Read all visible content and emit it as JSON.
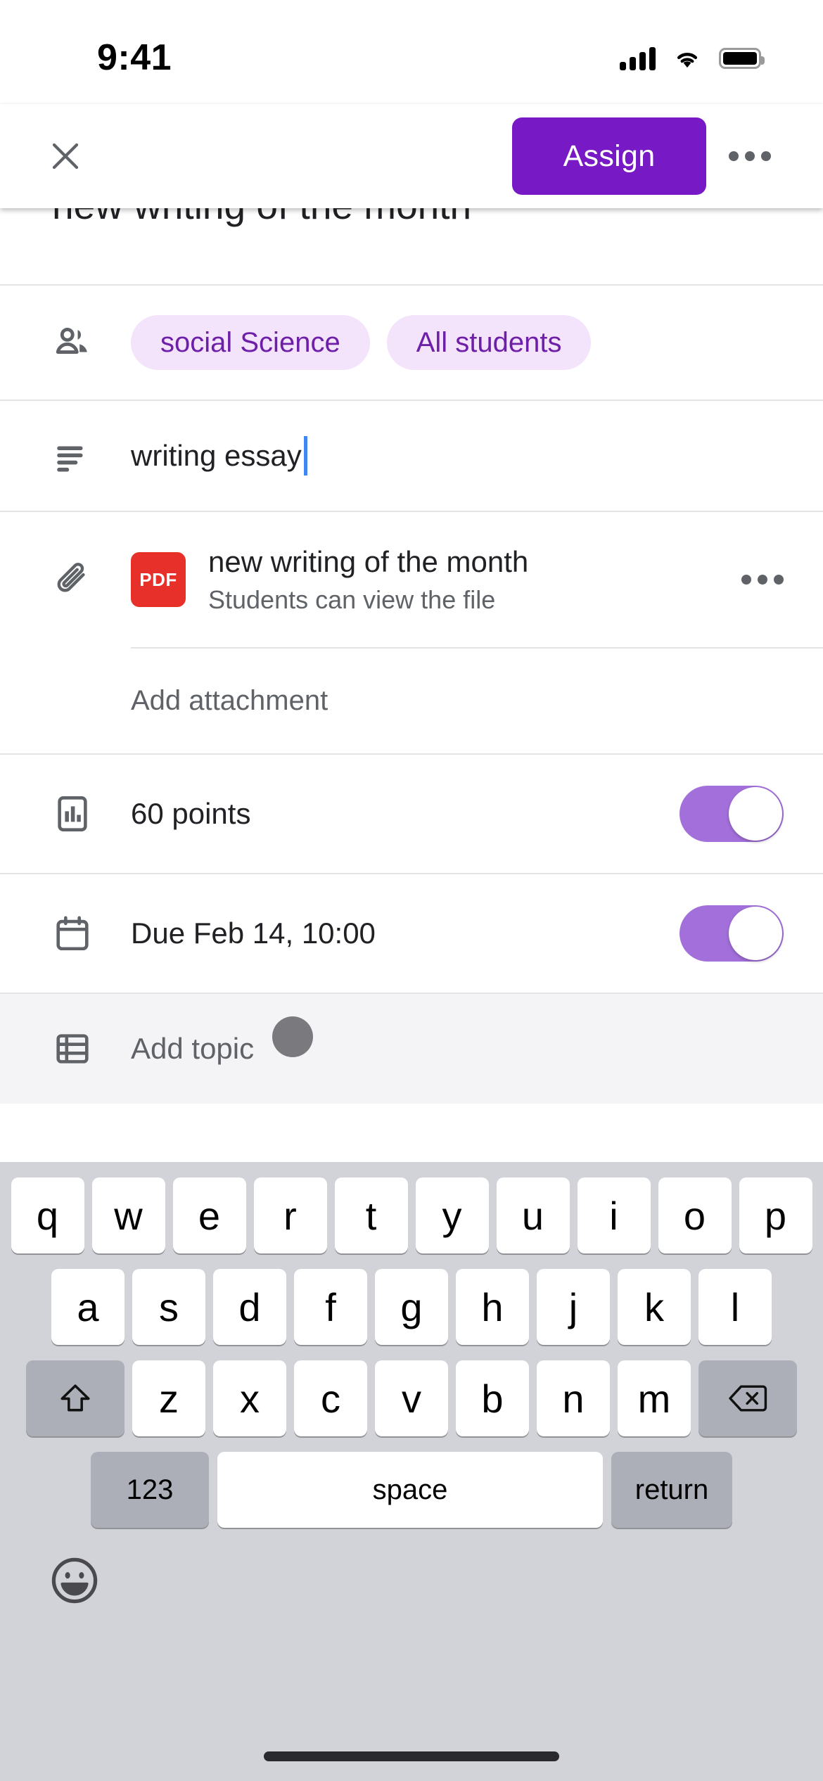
{
  "statusbar": {
    "time": "9:41",
    "signal_icon": "cellular-signal-icon",
    "wifi_icon": "wifi-icon",
    "battery_icon": "battery-full-icon"
  },
  "header": {
    "close_icon": "close-icon",
    "assign_label": "Assign",
    "overflow_icon": "more-options-icon",
    "accent_color": "#7719C4"
  },
  "scrolled_title": "new writing of the month",
  "audience": {
    "icon": "people-icon",
    "chips": [
      {
        "label": "social Science"
      },
      {
        "label": "All students"
      }
    ],
    "chip_bg": "#F3E3FB",
    "chip_fg": "#6E1FA8"
  },
  "instructions": {
    "icon": "description-lines-icon",
    "value": "writing essay",
    "caret_color": "#4285F4"
  },
  "attachment": {
    "icon": "paperclip-icon",
    "file_type_badge": "PDF",
    "badge_color": "#E8302B",
    "title": "new writing of the month",
    "subtitle": "Students can view the file",
    "more_icon": "attachment-more-icon",
    "add_label": "Add attachment"
  },
  "points": {
    "icon": "bar-chart-icon",
    "label": "60 points",
    "toggle_on": true,
    "toggle_color": "#A370DB"
  },
  "due": {
    "icon": "calendar-icon",
    "label": "Due Feb 14, 10:00",
    "toggle_on": true,
    "toggle_color": "#A370DB"
  },
  "topic": {
    "icon": "topic-list-icon",
    "label": "Add topic",
    "touch_indicator": true
  },
  "keyboard": {
    "row1": [
      "q",
      "w",
      "e",
      "r",
      "t",
      "y",
      "u",
      "i",
      "o",
      "p"
    ],
    "row2": [
      "a",
      "s",
      "d",
      "f",
      "g",
      "h",
      "j",
      "k",
      "l"
    ],
    "row3": [
      "z",
      "x",
      "c",
      "v",
      "b",
      "n",
      "m"
    ],
    "shift_icon": "shift-icon",
    "backspace_icon": "backspace-icon",
    "numbers_label": "123",
    "space_label": "space",
    "return_label": "return",
    "emoji_icon": "emoji-icon"
  }
}
